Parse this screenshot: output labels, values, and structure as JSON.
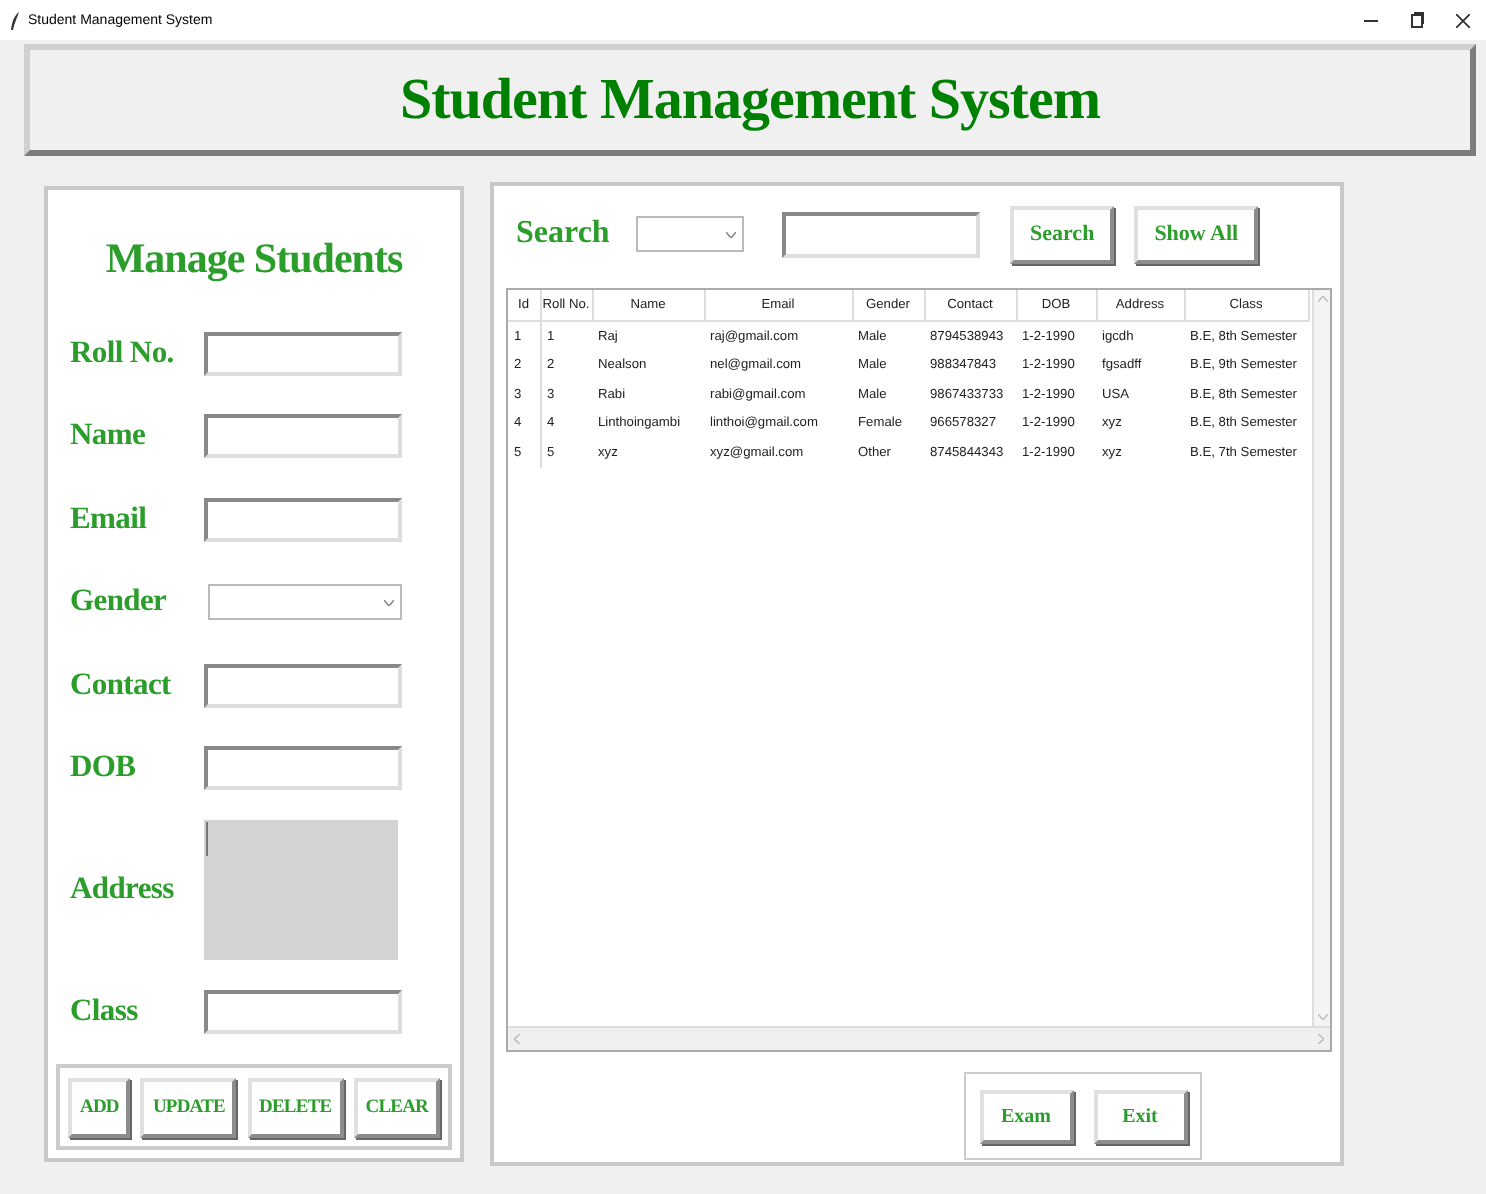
{
  "window": {
    "title": "Student Management System"
  },
  "header": {
    "title": "Student Management System"
  },
  "manage": {
    "title": "Manage Students",
    "fields": [
      {
        "label": "Roll No.",
        "kind": "entry"
      },
      {
        "label": "Name",
        "kind": "entry"
      },
      {
        "label": "Email",
        "kind": "entry"
      },
      {
        "label": "Gender",
        "kind": "combo"
      },
      {
        "label": "Contact",
        "kind": "entry"
      },
      {
        "label": "DOB",
        "kind": "entry"
      },
      {
        "label": "Address",
        "kind": "text"
      },
      {
        "label": "Class",
        "kind": "entry"
      }
    ],
    "buttons": [
      "ADD",
      "UPDATE",
      "DELETE",
      "CLEAR"
    ]
  },
  "search": {
    "label": "Search",
    "buttons": [
      "Search",
      "Show All"
    ]
  },
  "table": {
    "columns": [
      "Id",
      "Roll No.",
      "Name",
      "Email",
      "Gender",
      "Contact",
      "DOB",
      "Address",
      "Class"
    ],
    "rows": [
      [
        "1",
        "1",
        "Raj",
        "raj@gmail.com",
        "Male",
        "8794538943",
        "1-2-1990",
        "igcdh",
        "B.E, 8th Semester"
      ],
      [
        "2",
        "2",
        "Nealson",
        "nel@gmail.com",
        "Male",
        "988347843",
        "1-2-1990",
        "fgsadff",
        "B.E, 9th Semester"
      ],
      [
        "3",
        "3",
        "Rabi",
        "rabi@gmail.com",
        "Male",
        "9867433733",
        "1-2-1990",
        "USA",
        "B.E, 8th Semester"
      ],
      [
        "4",
        "4",
        "Linthoingambi",
        "linthoi@gmail.com",
        "Female",
        "966578327",
        "1-2-1990",
        "xyz",
        "B.E, 8th Semester"
      ],
      [
        "5",
        "5",
        "xyz",
        "xyz@gmail.com",
        "Other",
        "8745844343",
        "1-2-1990",
        "xyz",
        "B.E, 7th Semester"
      ]
    ]
  },
  "footer_buttons": [
    "Exam",
    "Exit"
  ]
}
